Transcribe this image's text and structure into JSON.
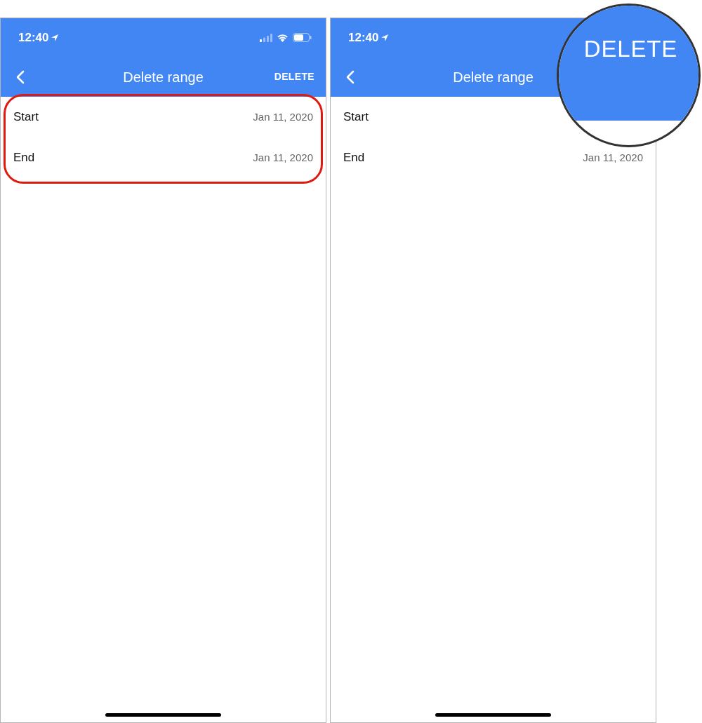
{
  "screens": [
    {
      "status_bar": {
        "time": "12:40",
        "status_icons": true
      },
      "header": {
        "title": "Delete range",
        "action": "DELETE"
      },
      "highlighted": true,
      "rows": [
        {
          "label": "Start",
          "value": "Jan 11, 2020"
        },
        {
          "label": "End",
          "value": "Jan 11, 2020"
        }
      ]
    },
    {
      "status_bar": {
        "time": "12:40"
      },
      "header": {
        "title": "Delete range"
      },
      "highlighted": false,
      "rows": [
        {
          "label": "Start"
        },
        {
          "label": "End",
          "value": "Jan 11, 2020"
        }
      ]
    }
  ],
  "magnifier": {
    "text": "DELETE"
  }
}
